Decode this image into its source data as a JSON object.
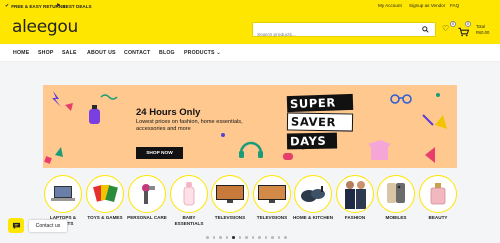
{
  "topbar": {
    "promo_returns": "FREE & EASY RETURNS",
    "promo_deals": "BEST DEALS",
    "my_account": "My Account",
    "signup_vendor": "Signup as Vendor",
    "faq": "FAQ"
  },
  "header": {
    "logo": "aleegou",
    "search_placeholder": "Search products...",
    "wishlist_count": "0",
    "cart_count": "0",
    "total_label": "Total",
    "total_value": "Rs0.00"
  },
  "nav": {
    "items": [
      "HOME",
      "SHOP",
      "SALE",
      "ABOUT US",
      "CONTACT",
      "BLOG",
      "PRODUCTS"
    ],
    "products_chevron": "⌄"
  },
  "banner": {
    "title": "24 Hours Only",
    "subtitle": "Lowest prices on fashion, home essentials, accessories and more",
    "cta": "SHOP NOW",
    "saver_lines": [
      "SUPER",
      "SAVER",
      "DAYS"
    ]
  },
  "categories": [
    {
      "label": "LAPTOPS & TABLETS",
      "icon": "laptop-icon"
    },
    {
      "label": "TOYS & GAMES",
      "icon": "cards-icon"
    },
    {
      "label": "PERSONAL CARE",
      "icon": "hairdryer-icon"
    },
    {
      "label": "BABY ESSENTIALS",
      "icon": "bottle-icon"
    },
    {
      "label": "TELEVISIONS",
      "icon": "tv-icon"
    },
    {
      "label": "TELEVISIONS",
      "icon": "tv-icon"
    },
    {
      "label": "HOME & KITCHEN",
      "icon": "cookware-icon"
    },
    {
      "label": "FASHION",
      "icon": "people-icon"
    },
    {
      "label": "MOBILES",
      "icon": "phone-icon"
    },
    {
      "label": "BEAUTY",
      "icon": "perfume-icon"
    }
  ],
  "carousel": {
    "total_dots": 13,
    "active_index": 4
  },
  "chat": {
    "contact_label": "Contact us"
  },
  "colors": {
    "brand": "#ffe600",
    "banner_bg": "#ffc88f",
    "dark": "#111111"
  }
}
